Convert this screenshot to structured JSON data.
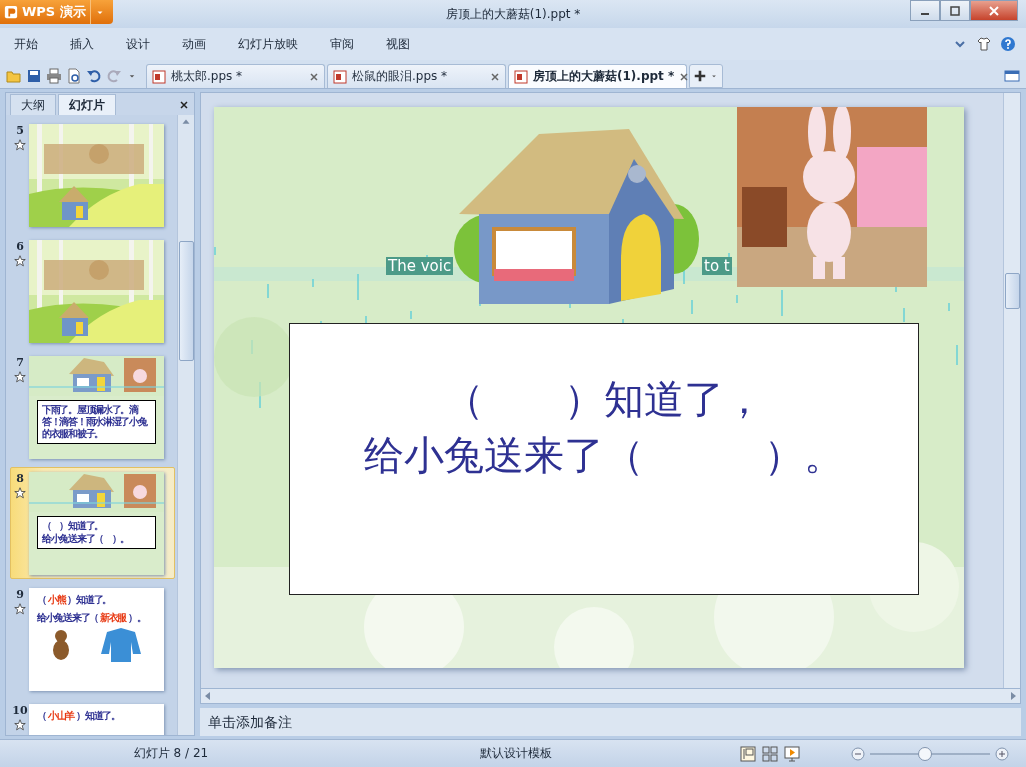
{
  "window": {
    "app_button": "WPS 演示",
    "title": "房顶上的大蘑菇(1).ppt *"
  },
  "menu": [
    {
      "label": "开始"
    },
    {
      "label": "插入"
    },
    {
      "label": "设计"
    },
    {
      "label": "动画"
    },
    {
      "label": "幻灯片放映"
    },
    {
      "label": "审阅"
    },
    {
      "label": "视图"
    }
  ],
  "doc_tabs": [
    {
      "label": "桃太郎.pps *",
      "selected": false
    },
    {
      "label": "松鼠的眼泪.pps *",
      "selected": false
    },
    {
      "label": "房顶上的大蘑菇(1).ppt *",
      "selected": true
    }
  ],
  "panel_tabs": [
    {
      "label": "大纲",
      "selected": false
    },
    {
      "label": "幻灯片",
      "selected": true
    }
  ],
  "slides": [
    {
      "number": "5",
      "selected": false,
      "kind": "forest"
    },
    {
      "number": "6",
      "selected": false,
      "kind": "forest"
    },
    {
      "number": "7",
      "selected": false,
      "kind": "house",
      "lines": [
        [
          {
            "text": "下雨了。屋顶漏水了。滴答！滴答！雨水淋湿了小兔的衣服和被子。",
            "highlight": false
          }
        ]
      ]
    },
    {
      "number": "8",
      "selected": true,
      "kind": "house",
      "lines": [
        [
          {
            "text": "（　）知道了。",
            "highlight": false
          }
        ],
        [
          {
            "text": "给小兔送来了（　）。",
            "highlight": false
          }
        ]
      ]
    },
    {
      "number": "9",
      "selected": false,
      "kind": "white",
      "lines": [
        [
          {
            "text": "（ ",
            "highlight": false
          },
          {
            "text": "小熊",
            "highlight": true
          },
          {
            "text": " ）知道了。",
            "highlight": false
          }
        ],
        [
          {
            "text": "给小兔送来了（ ",
            "highlight": false
          },
          {
            "text": "新衣服",
            "highlight": true
          },
          {
            "text": " ）。",
            "highlight": false
          }
        ]
      ]
    },
    {
      "number": "10",
      "selected": false,
      "kind": "white",
      "lines": [
        [
          {
            "text": "（ ",
            "highlight": false
          },
          {
            "text": "小山羊",
            "highlight": true
          },
          {
            "text": " ）知道了。",
            "highlight": false
          }
        ]
      ]
    }
  ],
  "slide": {
    "captions": [
      "The voic",
      "to t"
    ],
    "lines": [
      "（　　）知道了，",
      "给小兔送来了（　　　）。"
    ]
  },
  "notes": {
    "placeholder": "单击添加备注"
  },
  "status_bar": {
    "slide_count": "幻灯片 8 / 21",
    "template": "默认设计模板",
    "zoom": {
      "level": 0.45
    }
  }
}
